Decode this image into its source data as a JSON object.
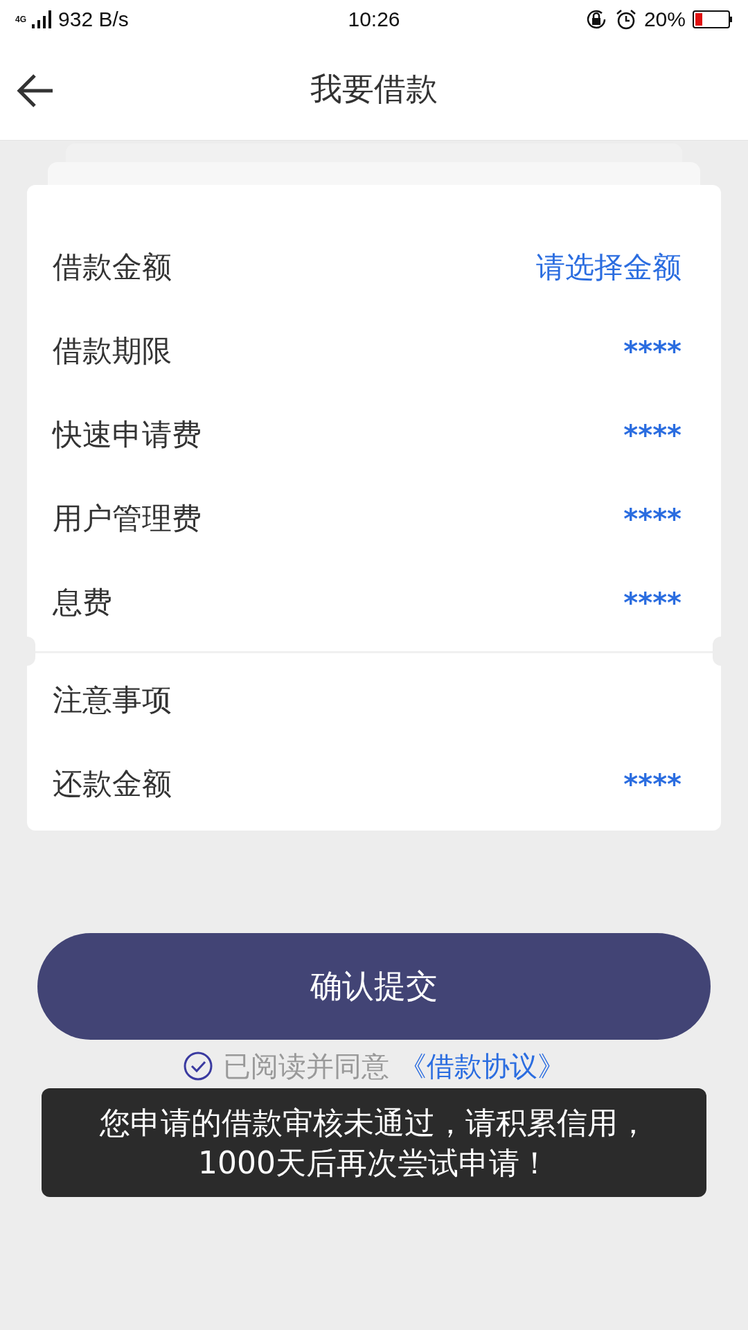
{
  "status_bar": {
    "network": "4G",
    "speed": "932 B/s",
    "time": "10:26",
    "battery": "20%"
  },
  "header": {
    "title": "我要借款"
  },
  "details": [
    {
      "label": "借款金额",
      "value": "请选择金额",
      "kind": "link"
    },
    {
      "label": "借款期限",
      "value": "****",
      "kind": "masked"
    },
    {
      "label": "快速申请费",
      "value": "****",
      "kind": "masked"
    },
    {
      "label": "用户管理费",
      "value": "****",
      "kind": "masked"
    },
    {
      "label": "息费",
      "value": "****",
      "kind": "masked"
    }
  ],
  "summary": [
    {
      "label": "注意事项",
      "kind": "plain"
    },
    {
      "label": "还款金额",
      "value": "****",
      "kind": "masked"
    }
  ],
  "submit_button": "确认提交",
  "agreement": {
    "checked": true,
    "text": "已阅读并同意",
    "link": "《借款协议》"
  },
  "toast": [
    "您申请的借款审核未通过，请积累信用，",
    "1000天后再次尝试申请！"
  ]
}
